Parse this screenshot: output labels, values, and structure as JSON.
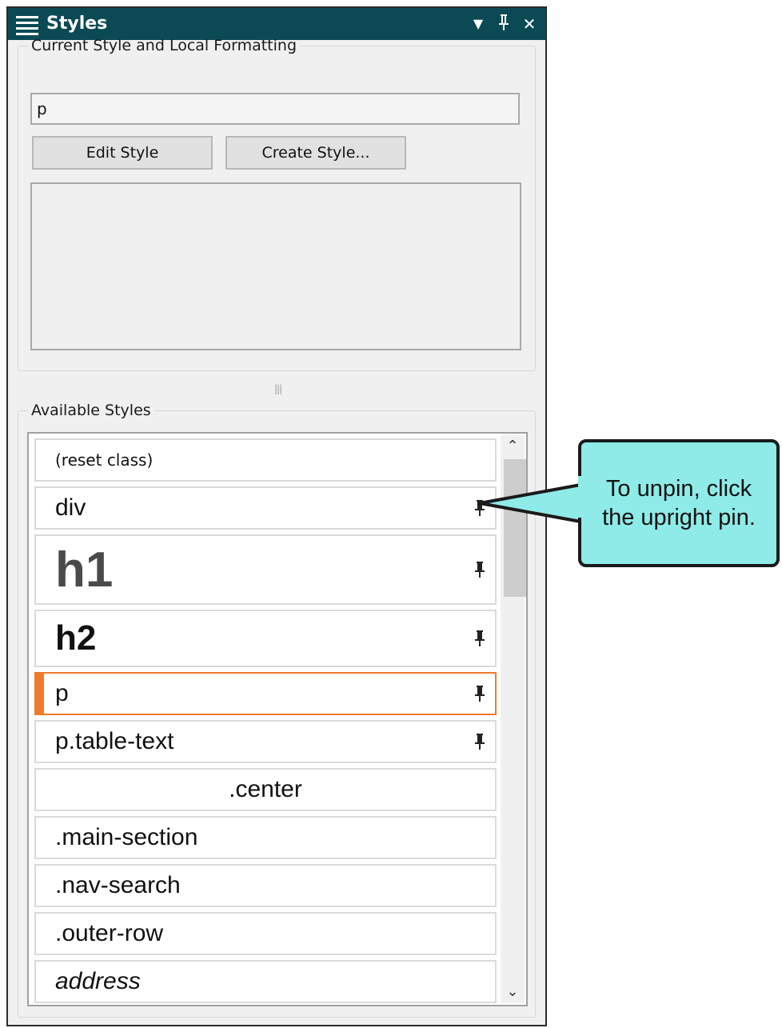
{
  "panel": {
    "title": "Styles",
    "controls": {
      "dropdown": "▼",
      "pin": "pin",
      "close": "✕"
    }
  },
  "current_style": {
    "legend": "Current Style and Local Formatting",
    "value": "p",
    "edit_button": "Edit Style",
    "create_button": "Create Style..."
  },
  "available": {
    "legend": "Available Styles",
    "items": [
      {
        "label": "(reset class)",
        "pinned": false
      },
      {
        "label": "div",
        "pinned": true
      },
      {
        "label": "h1",
        "pinned": true
      },
      {
        "label": "h2",
        "pinned": true
      },
      {
        "label": "p",
        "pinned": true,
        "selected": true
      },
      {
        "label": "p.table-text",
        "pinned": true
      },
      {
        "label": ".center",
        "pinned": false
      },
      {
        "label": ".main-section",
        "pinned": false
      },
      {
        "label": ".nav-search",
        "pinned": false
      },
      {
        "label": ".outer-row",
        "pinned": false
      },
      {
        "label": "address",
        "pinned": false
      }
    ]
  },
  "callout": {
    "line1": "To unpin, click",
    "line2": "the upright pin.",
    "fill": "#8eebe7"
  },
  "colors": {
    "titlebar": "#0b4a55",
    "selected": "#f07a2b"
  }
}
